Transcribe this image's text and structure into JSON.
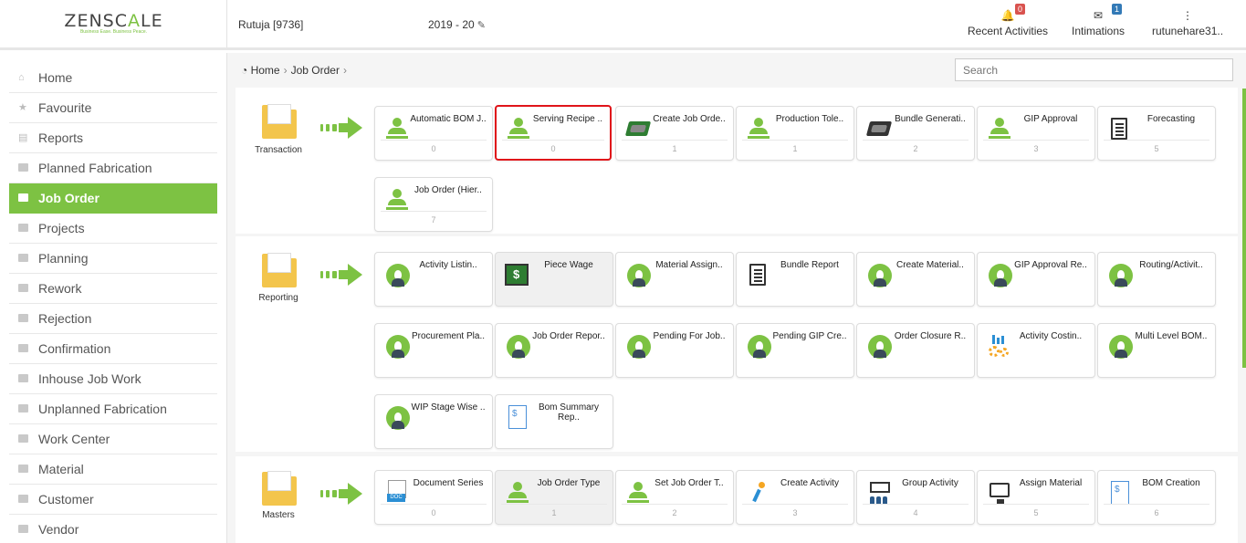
{
  "header": {
    "logo_prefix": "ZENSC",
    "logo_accent": "A",
    "logo_suffix": "LE",
    "logo_tagline": "Business Ease. Business Peace.",
    "user_id": "Rutuja [9736]",
    "financial_year": "2019 - 20",
    "recent_activities_label": "Recent Activities",
    "recent_activities_count": "0",
    "intimations_label": "Intimations",
    "intimations_count": "1",
    "username": "rutunehare31.."
  },
  "sidebar": {
    "items": [
      {
        "label": "Home",
        "icon": "home-icon"
      },
      {
        "label": "Favourite",
        "icon": "star-icon"
      },
      {
        "label": "Reports",
        "icon": "file-icon"
      },
      {
        "label": "Planned Fabrication",
        "icon": "folder-icon"
      },
      {
        "label": "Job Order",
        "icon": "folder-icon",
        "active": true
      },
      {
        "label": "Projects",
        "icon": "folder-icon"
      },
      {
        "label": "Planning",
        "icon": "folder-icon"
      },
      {
        "label": "Rework",
        "icon": "folder-icon"
      },
      {
        "label": "Rejection",
        "icon": "folder-icon"
      },
      {
        "label": "Confirmation",
        "icon": "folder-icon"
      },
      {
        "label": "Inhouse Job Work",
        "icon": "folder-icon"
      },
      {
        "label": "Unplanned Fabrication",
        "icon": "folder-icon"
      },
      {
        "label": "Work Center",
        "icon": "folder-icon"
      },
      {
        "label": "Material",
        "icon": "folder-icon"
      },
      {
        "label": "Customer",
        "icon": "folder-icon"
      },
      {
        "label": "Vendor",
        "icon": "folder-icon"
      }
    ]
  },
  "breadcrumb": {
    "home": "Home",
    "current": "Job Order"
  },
  "search": {
    "placeholder": "Search"
  },
  "sections": {
    "transaction": {
      "label": "Transaction",
      "cards": [
        {
          "label": "Automatic BOM J..",
          "count": "0"
        },
        {
          "label": "Serving Recipe ..",
          "count": "0"
        },
        {
          "label": "Create Job Orde..",
          "count": "1"
        },
        {
          "label": "Production Tole..",
          "count": "1"
        },
        {
          "label": "Bundle Generati..",
          "count": "2"
        },
        {
          "label": "GIP Approval",
          "count": "3"
        },
        {
          "label": "Forecasting",
          "count": "5"
        },
        {
          "label": "Job Order (Hier..",
          "count": "7"
        }
      ]
    },
    "reporting": {
      "label": "Reporting",
      "cards": [
        {
          "label": "Activity Listin.."
        },
        {
          "label": "Piece Wage"
        },
        {
          "label": "Material Assign.."
        },
        {
          "label": "Bundle Report"
        },
        {
          "label": "Create Material.."
        },
        {
          "label": "GIP Approval Re.."
        },
        {
          "label": "Routing/Activit.."
        },
        {
          "label": "Procurement Pla.."
        },
        {
          "label": "Job Order Repor.."
        },
        {
          "label": "Pending For Job.."
        },
        {
          "label": "Pending GIP Cre.."
        },
        {
          "label": "Order Closure R.."
        },
        {
          "label": "Activity Costin.."
        },
        {
          "label": "Multi Level BOM.."
        },
        {
          "label": "WIP Stage Wise .."
        },
        {
          "label": "Bom Summary Rep.."
        }
      ]
    },
    "masters": {
      "label": "Masters",
      "cards": [
        {
          "label": "Document Series",
          "count": "0"
        },
        {
          "label": "Job Order Type",
          "count": "1"
        },
        {
          "label": "Set Job Order T..",
          "count": "2"
        },
        {
          "label": "Create Activity",
          "count": "3"
        },
        {
          "label": "Group Activity",
          "count": "4"
        },
        {
          "label": "Assign Material",
          "count": "5"
        },
        {
          "label": "BOM Creation",
          "count": "6"
        }
      ]
    }
  },
  "colors": {
    "accent": "#7dc243",
    "highlight": "#e0141a"
  }
}
